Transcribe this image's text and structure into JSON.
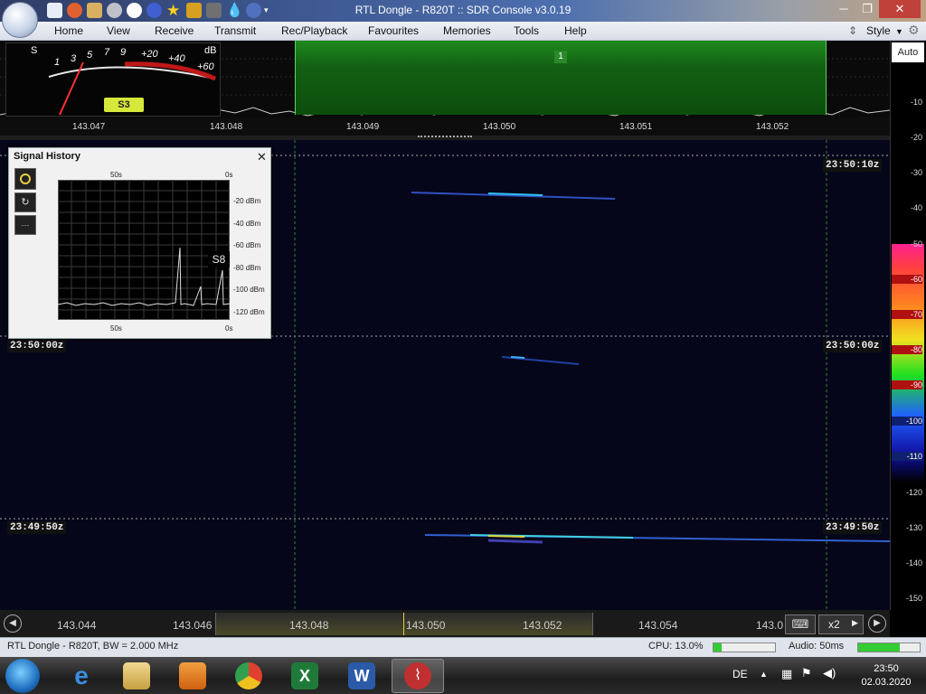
{
  "window": {
    "title": "RTL Dongle - R820T :: SDR Console v3.0.19"
  },
  "menu": [
    "Home",
    "View",
    "Receive",
    "Transmit",
    "Rec/Playback",
    "Favourites",
    "Memories",
    "Tools",
    "Help"
  ],
  "style_label": "Style",
  "spectrum": {
    "passband_label": "1",
    "freq_ticks": [
      "143.047",
      "143.048",
      "143.049",
      "143.050",
      "143.051",
      "143.052"
    ],
    "meter": {
      "s_label": "S",
      "db_label": "dB",
      "scale": [
        "1",
        "3",
        "5",
        "7",
        "9",
        "+20",
        "+40",
        "+60"
      ],
      "reading": "S3"
    }
  },
  "right_scale": {
    "auto_label": "Auto",
    "levels": [
      "-10",
      "-20",
      "-30",
      "-40",
      "-50",
      "-60",
      "-70",
      "-80",
      "-90",
      "-100",
      "-110",
      "-120",
      "-130",
      "-140",
      "-150"
    ]
  },
  "waterfall": {
    "timestamps": [
      "23:50:10z",
      "23:50:00z",
      "23:49:50z"
    ]
  },
  "signal_history": {
    "title": "Signal History",
    "top_left": "50s",
    "top_right": "0s",
    "bottom_left": "50s",
    "bottom_right": "0s",
    "levels": [
      "-20 dBm",
      "-40 dBm",
      "-60 dBm",
      "-80 dBm",
      "-100 dBm",
      "-120 dBm"
    ],
    "s_reading": "S8"
  },
  "tuning_bar": {
    "ticks": [
      "143.044",
      "143.046",
      "143.048",
      "143.050",
      "143.052",
      "143.054",
      "143.0"
    ],
    "zoom": "x2"
  },
  "status": {
    "device": "RTL Dongle - R820T, BW = 2.000 MHz",
    "cpu": "CPU: 13.0%",
    "audio": "Audio: 50ms"
  },
  "taskbar": {
    "lang": "DE",
    "time": "23:50",
    "date": "02.03.2020"
  }
}
